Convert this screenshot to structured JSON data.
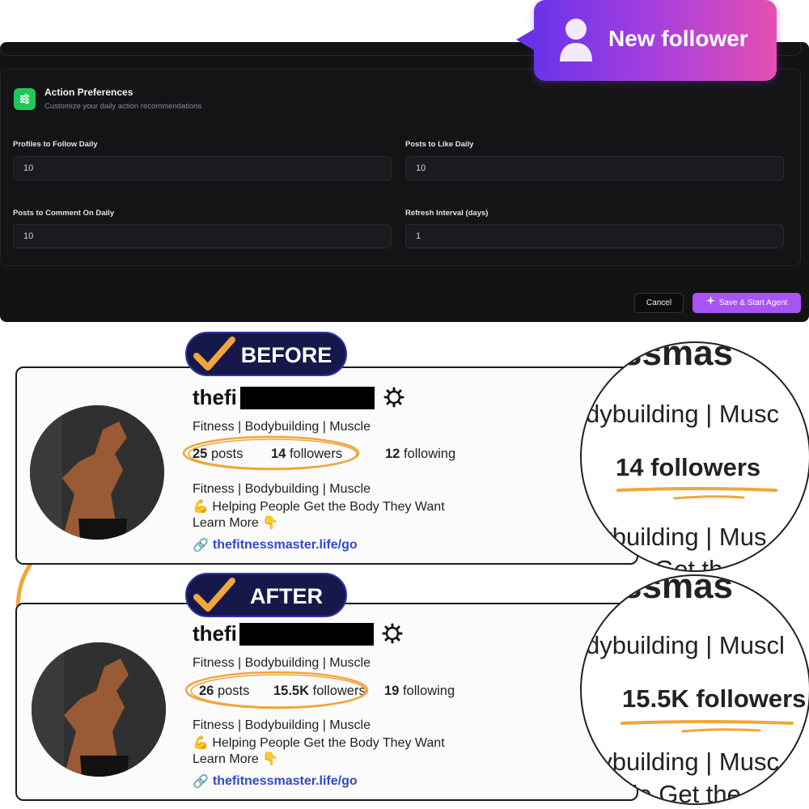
{
  "toast": {
    "text": "New follower",
    "icon": "user-icon"
  },
  "panel": {
    "section_title": "Action Preferences",
    "section_subtitle": "Customize your daily action recommendations",
    "section_icon": "sliders-icon",
    "fields": [
      {
        "label": "Profiles to Follow Daily",
        "value": "10"
      },
      {
        "label": "Posts to Like Daily",
        "value": "10"
      },
      {
        "label": "Posts to Comment On Daily",
        "value": "10"
      },
      {
        "label": "Refresh Interval (days)",
        "value": "1"
      }
    ],
    "cancel_label": "Cancel",
    "save_label": "Save & Start Agent"
  },
  "before": {
    "badge": "BEFORE",
    "username": "thefi",
    "category": "Fitness | Bodybuilding | Muscle",
    "posts_num": "25",
    "posts_label": "posts",
    "followers_num": "14",
    "followers_label": "followers",
    "following_num": "12",
    "following_label": "following",
    "bio1": "Fitness | Bodybuilding | Muscle",
    "bio2": "💪 Helping People Get the Body They Want",
    "bio3": "Learn More 👇",
    "link": "thefitnessmaster.life/go",
    "zoom": {
      "top": "ssmas",
      "row1": "dybuilding | Musc",
      "highlight": "14 followers",
      "row2": "dybuilding | Mus",
      "row3": "ple Get th"
    }
  },
  "after": {
    "badge": "AFTER",
    "username": "thefi",
    "category": "Fitness | Bodybuilding | Muscle",
    "posts_num": "26",
    "posts_label": "posts",
    "followers_num": "15.5K",
    "followers_label": "followers",
    "following_num": "19",
    "following_label": "following",
    "bio1": "Fitness | Bodybuilding | Muscle",
    "bio2": "💪 Helping People Get the Body They Want",
    "bio3": "Learn More 👇",
    "link": "thefitnessmaster.life/go",
    "zoom": {
      "top": "ssmas",
      "row1": "dybuilding | Muscl",
      "highlight": "15.5K followers",
      "row2": "dybuilding | Musc",
      "row3": "ople Get the"
    }
  },
  "colors": {
    "accent_purple": "#a855f7",
    "highlight_orange": "#f0a63a",
    "badge_navy": "#16184a",
    "link_blue": "#2f49c8"
  }
}
